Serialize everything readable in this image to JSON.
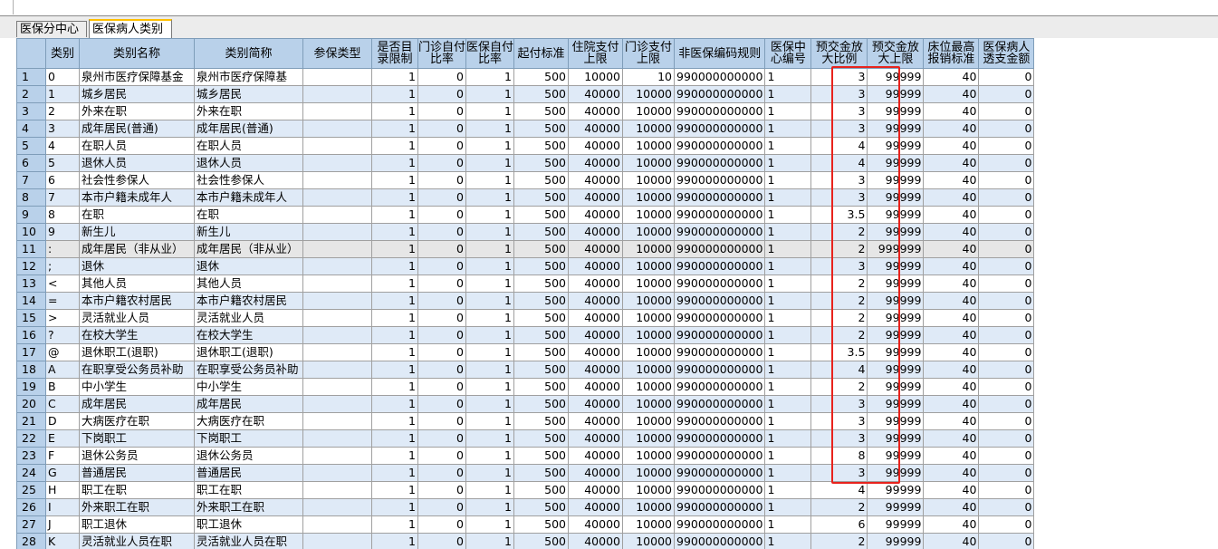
{
  "tabs": [
    {
      "label": "医保分中心"
    },
    {
      "label": "医保病人类别"
    }
  ],
  "columns": [
    "",
    "类别",
    "类别名称",
    "类别简称",
    "参保类型",
    "是否目录限制",
    "门诊自付比率",
    "医保自付比率",
    "起付标准",
    "住院支付上限",
    "门诊支付上限",
    "非医保编码规则",
    "医保中心编号",
    "预交金放大比例",
    "预交金放大上限",
    "床位最高报销标准",
    "医保病人透支金额"
  ],
  "rows": [
    [
      "1",
      "0",
      "泉州市医疗保障基金",
      "泉州市医疗保障基",
      "",
      "1",
      "0",
      "1",
      "500",
      "10000",
      "10",
      "990000000000",
      "1",
      "3",
      "99999",
      "40",
      "0"
    ],
    [
      "2",
      "1",
      "城乡居民",
      "城乡居民",
      "",
      "1",
      "0",
      "1",
      "500",
      "40000",
      "10000",
      "990000000000",
      "1",
      "3",
      "99999",
      "40",
      "0"
    ],
    [
      "3",
      "2",
      "外来在职",
      "外来在职",
      "",
      "1",
      "0",
      "1",
      "500",
      "40000",
      "10000",
      "990000000000",
      "1",
      "3",
      "99999",
      "40",
      "0"
    ],
    [
      "4",
      "3",
      "成年居民(普通)",
      "成年居民(普通)",
      "",
      "1",
      "0",
      "1",
      "500",
      "40000",
      "10000",
      "990000000000",
      "1",
      "3",
      "99999",
      "40",
      "0"
    ],
    [
      "5",
      "4",
      "在职人员",
      "在职人员",
      "",
      "1",
      "0",
      "1",
      "500",
      "40000",
      "10000",
      "990000000000",
      "1",
      "4",
      "99999",
      "40",
      "0"
    ],
    [
      "6",
      "5",
      "退休人员",
      "退休人员",
      "",
      "1",
      "0",
      "1",
      "500",
      "40000",
      "10000",
      "990000000000",
      "1",
      "4",
      "99999",
      "40",
      "0"
    ],
    [
      "7",
      "6",
      "社会性参保人",
      "社会性参保人",
      "",
      "1",
      "0",
      "1",
      "500",
      "40000",
      "10000",
      "990000000000",
      "1",
      "3",
      "99999",
      "40",
      "0"
    ],
    [
      "8",
      "7",
      "本市户籍未成年人",
      "本市户籍未成年人",
      "",
      "1",
      "0",
      "1",
      "500",
      "40000",
      "10000",
      "990000000000",
      "1",
      "3",
      "99999",
      "40",
      "0"
    ],
    [
      "9",
      "8",
      "在职",
      "在职",
      "",
      "1",
      "0",
      "1",
      "500",
      "40000",
      "10000",
      "990000000000",
      "1",
      "3.5",
      "99999",
      "40",
      "0"
    ],
    [
      "10",
      "9",
      "新生儿",
      "新生儿",
      "",
      "1",
      "0",
      "1",
      "500",
      "40000",
      "10000",
      "990000000000",
      "1",
      "2",
      "99999",
      "40",
      "0"
    ],
    [
      "11",
      ":",
      "成年居民（非从业）",
      "成年居民（非从业）",
      "",
      "1",
      "0",
      "1",
      "500",
      "40000",
      "10000",
      "990000000000",
      "1",
      "2",
      "999999",
      "40",
      "0"
    ],
    [
      "12",
      ";",
      "退休",
      "退休",
      "",
      "1",
      "0",
      "1",
      "500",
      "40000",
      "10000",
      "990000000000",
      "1",
      "3",
      "99999",
      "40",
      "0"
    ],
    [
      "13",
      "<",
      "其他人员",
      "其他人员",
      "",
      "1",
      "0",
      "1",
      "500",
      "40000",
      "10000",
      "990000000000",
      "1",
      "2",
      "99999",
      "40",
      "0"
    ],
    [
      "14",
      "=",
      "本市户籍农村居民",
      "本市户籍农村居民",
      "",
      "1",
      "0",
      "1",
      "500",
      "40000",
      "10000",
      "990000000000",
      "1",
      "2",
      "99999",
      "40",
      "0"
    ],
    [
      "15",
      ">",
      "灵活就业人员",
      "灵活就业人员",
      "",
      "1",
      "0",
      "1",
      "500",
      "40000",
      "10000",
      "990000000000",
      "1",
      "2",
      "99999",
      "40",
      "0"
    ],
    [
      "16",
      "?",
      "在校大学生",
      "在校大学生",
      "",
      "1",
      "0",
      "1",
      "500",
      "40000",
      "10000",
      "990000000000",
      "1",
      "2",
      "99999",
      "40",
      "0"
    ],
    [
      "17",
      "@",
      "退休职工(退职)",
      "退休职工(退职)",
      "",
      "1",
      "0",
      "1",
      "500",
      "40000",
      "10000",
      "990000000000",
      "1",
      "3.5",
      "99999",
      "40",
      "0"
    ],
    [
      "18",
      "A",
      "在职享受公务员补助",
      "在职享受公务员补助",
      "",
      "1",
      "0",
      "1",
      "500",
      "40000",
      "10000",
      "990000000000",
      "1",
      "4",
      "99999",
      "40",
      "0"
    ],
    [
      "19",
      "B",
      "中小学生",
      "中小学生",
      "",
      "1",
      "0",
      "1",
      "500",
      "40000",
      "10000",
      "990000000000",
      "1",
      "2",
      "99999",
      "40",
      "0"
    ],
    [
      "20",
      "C",
      "成年居民",
      "成年居民",
      "",
      "1",
      "0",
      "1",
      "500",
      "40000",
      "10000",
      "990000000000",
      "1",
      "3",
      "99999",
      "40",
      "0"
    ],
    [
      "21",
      "D",
      "大病医疗在职",
      "大病医疗在职",
      "",
      "1",
      "0",
      "1",
      "500",
      "40000",
      "10000",
      "990000000000",
      "1",
      "3",
      "99999",
      "40",
      "0"
    ],
    [
      "22",
      "E",
      "下岗职工",
      "下岗职工",
      "",
      "1",
      "0",
      "1",
      "500",
      "40000",
      "10000",
      "990000000000",
      "1",
      "3",
      "99999",
      "40",
      "0"
    ],
    [
      "23",
      "F",
      "退休公务员",
      "退休公务员",
      "",
      "1",
      "0",
      "1",
      "500",
      "40000",
      "10000",
      "990000000000",
      "1",
      "8",
      "99999",
      "40",
      "0"
    ],
    [
      "24",
      "G",
      "普通居民",
      "普通居民",
      "",
      "1",
      "0",
      "1",
      "500",
      "40000",
      "10000",
      "990000000000",
      "1",
      "3",
      "99999",
      "40",
      "0"
    ],
    [
      "25",
      "H",
      "职工在职",
      "职工在职",
      "",
      "1",
      "0",
      "1",
      "500",
      "40000",
      "10000",
      "990000000000",
      "1",
      "4",
      "99999",
      "40",
      "0"
    ],
    [
      "26",
      "I",
      "外来职工在职",
      "外来职工在职",
      "",
      "1",
      "0",
      "1",
      "500",
      "40000",
      "10000",
      "990000000000",
      "1",
      "2",
      "99999",
      "40",
      "0"
    ],
    [
      "27",
      "J",
      "职工退休",
      "职工退休",
      "",
      "1",
      "0",
      "1",
      "500",
      "40000",
      "10000",
      "990000000000",
      "1",
      "6",
      "99999",
      "40",
      "0"
    ],
    [
      "28",
      "K",
      "灵活就业人员在职",
      "灵活就业人员在职",
      "",
      "1",
      "0",
      "1",
      "500",
      "40000",
      "10000",
      "990000000000",
      "1",
      "2",
      "99999",
      "40",
      "0"
    ]
  ],
  "selected_row_index": 10,
  "highlight_color": "#e8231d",
  "header_color": "#b9d1ea",
  "alt_row_color": "#dfeaf7"
}
